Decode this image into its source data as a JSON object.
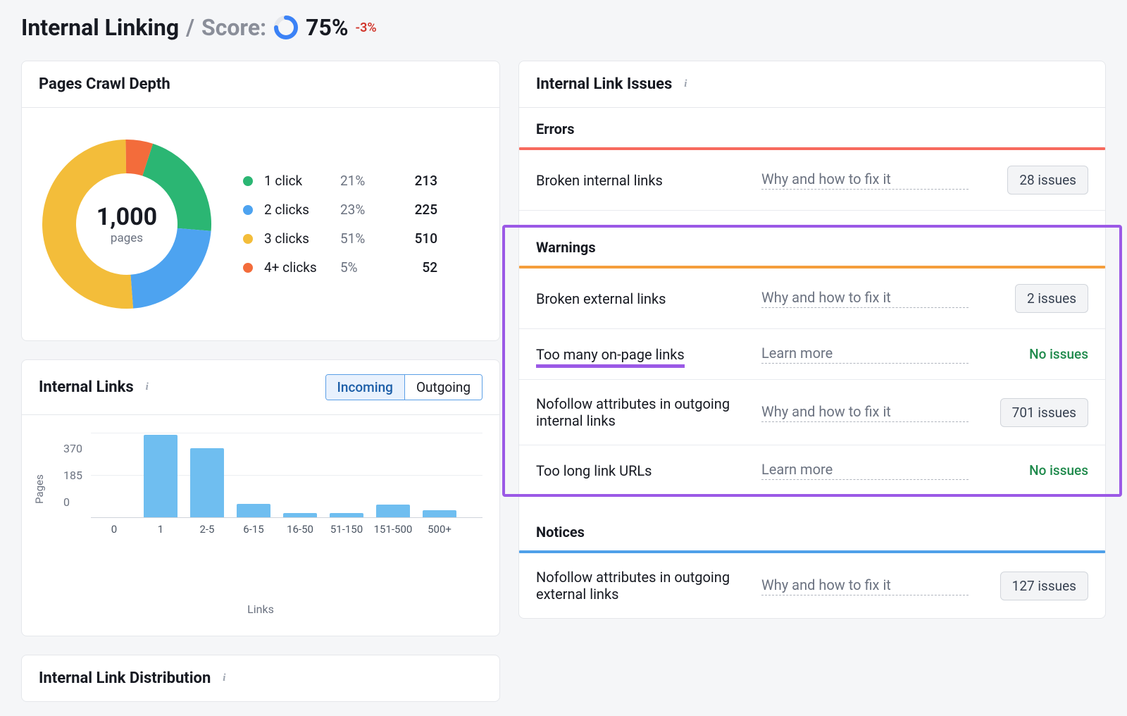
{
  "header": {
    "title": "Internal Linking",
    "score_label": "Score:",
    "score_value": "75%",
    "delta": "-3%"
  },
  "crawl_depth": {
    "title": "Pages Crawl Depth",
    "total": "1,000",
    "total_label": "pages",
    "legend": [
      {
        "label": "1 click",
        "pct": "21%",
        "count": "213",
        "color": "#2bb673"
      },
      {
        "label": "2 clicks",
        "pct": "23%",
        "count": "225",
        "color": "#4da3f0"
      },
      {
        "label": "3 clicks",
        "pct": "51%",
        "count": "510",
        "color": "#f3bd3a"
      },
      {
        "label": "4+ clicks",
        "pct": "5%",
        "count": "52",
        "color": "#f36c3b"
      }
    ]
  },
  "internal_links": {
    "title": "Internal Links",
    "tabs": {
      "incoming": "Incoming",
      "outgoing": "Outgoing"
    },
    "ylabel": "Pages",
    "xlabel": "Links"
  },
  "issues": {
    "title": "Internal Link Issues",
    "errors": {
      "title": "Errors",
      "rows": [
        {
          "name": "Broken internal links",
          "hint": "Why and how to fix it",
          "count": "28 issues"
        }
      ]
    },
    "warnings": {
      "title": "Warnings",
      "rows": [
        {
          "name": "Broken external links",
          "hint": "Why and how to fix it",
          "count": "2 issues"
        },
        {
          "name": "Too many on-page links",
          "hint": "Learn more",
          "no_issues": "No issues"
        },
        {
          "name": "Nofollow attributes in outgoing internal links",
          "hint": "Why and how to fix it",
          "count": "701 issues"
        },
        {
          "name": "Too long link URLs",
          "hint": "Learn more",
          "no_issues": "No issues"
        }
      ]
    },
    "notices": {
      "title": "Notices",
      "rows": [
        {
          "name": "Nofollow attributes in outgoing external links",
          "hint": "Why and how to fix it",
          "count": "127 issues"
        }
      ]
    }
  },
  "link_distribution": {
    "title": "Internal Link Distribution"
  },
  "chart_data": [
    {
      "type": "pie",
      "title": "Pages Crawl Depth",
      "total": 1000,
      "series": [
        {
          "name": "1 click",
          "value": 213,
          "pct": 21,
          "color": "#2bb673"
        },
        {
          "name": "2 clicks",
          "value": 225,
          "pct": 23,
          "color": "#4da3f0"
        },
        {
          "name": "3 clicks",
          "value": 510,
          "pct": 51,
          "color": "#f3bd3a"
        },
        {
          "name": "4+ clicks",
          "value": 52,
          "pct": 5,
          "color": "#f36c3b"
        }
      ]
    },
    {
      "type": "bar",
      "title": "Internal Links (Incoming)",
      "xlabel": "Links",
      "ylabel": "Pages",
      "ylim": [
        0,
        370
      ],
      "y_ticks": [
        0,
        185,
        370
      ],
      "categories": [
        "0",
        "1",
        "2-5",
        "6-15",
        "16-50",
        "51-150",
        "151-500",
        "500+"
      ],
      "values": [
        0,
        365,
        305,
        60,
        20,
        20,
        55,
        30
      ]
    }
  ]
}
